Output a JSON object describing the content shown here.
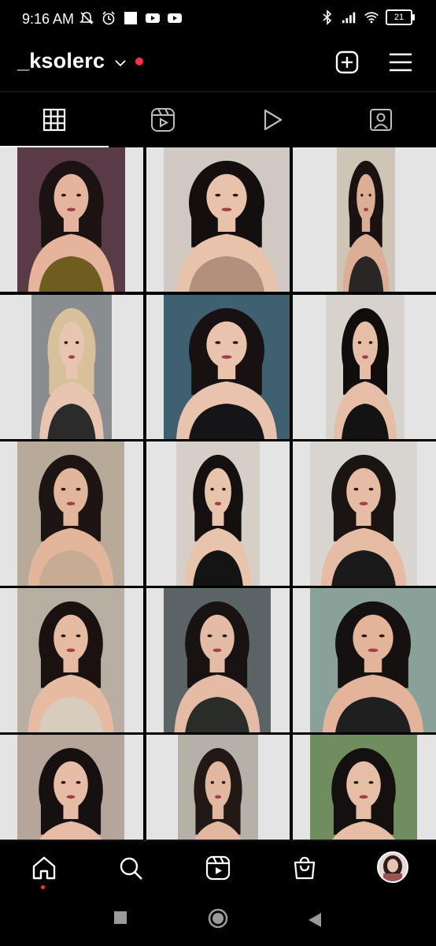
{
  "status_bar": {
    "time": "9:16 AM",
    "battery": "21",
    "left_icons": [
      "silent-bell-icon",
      "alarm-icon",
      "square-notification-icon",
      "youtube-icon",
      "youtube-icon"
    ],
    "right_icons": [
      "bluetooth-icon",
      "signal-icon",
      "wifi-icon",
      "battery-icon"
    ]
  },
  "header": {
    "username": "_ksolerc",
    "has_notification_dot": true,
    "accent_color": "#ff3040",
    "actions": [
      "new-post-icon",
      "menu-icon"
    ]
  },
  "tabs": [
    {
      "name": "grid",
      "icon": "grid-icon",
      "active": true
    },
    {
      "name": "reels",
      "icon": "reels-icon",
      "active": false
    },
    {
      "name": "videos",
      "icon": "play-icon",
      "active": false
    },
    {
      "name": "tagged",
      "icon": "tagged-person-icon",
      "active": false
    }
  ],
  "grid": {
    "rows": 5,
    "columns": 3,
    "posts": [
      {
        "id": "post-1"
      },
      {
        "id": "post-2"
      },
      {
        "id": "post-3"
      },
      {
        "id": "post-4"
      },
      {
        "id": "post-5"
      },
      {
        "id": "post-6"
      },
      {
        "id": "post-7"
      },
      {
        "id": "post-8"
      },
      {
        "id": "post-9"
      },
      {
        "id": "post-10"
      },
      {
        "id": "post-11"
      },
      {
        "id": "post-12"
      },
      {
        "id": "post-13"
      },
      {
        "id": "post-14"
      },
      {
        "id": "post-15"
      }
    ]
  },
  "bottom_nav": [
    "home-icon",
    "search-icon",
    "reels-icon",
    "shop-icon",
    "profile-avatar"
  ],
  "system_nav": [
    "recents-button",
    "home-button",
    "back-button"
  ]
}
